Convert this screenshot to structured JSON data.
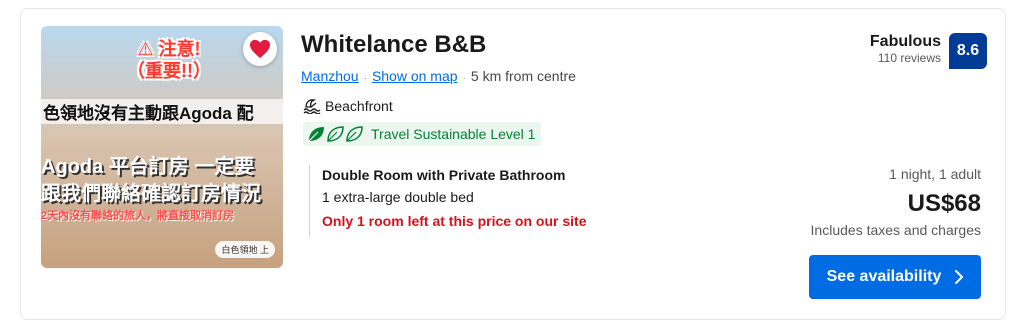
{
  "property": {
    "name": "Whitelance B&B",
    "location_link": "Manzhou",
    "map_link": "Show on map",
    "distance": "5 km from centre",
    "feature": "Beachfront",
    "sustainability": "Travel Sustainable Level 1"
  },
  "photo": {
    "warning_line1": "⚠ 注意!",
    "warning_line2": "（重要!!）",
    "text_line1": "色領地沒有主動跟Agoda 配",
    "text_line2": "Agoda 平台訂房 一定要",
    "text_line3": "跟我們聯絡確認訂房情況",
    "text_line4": "2天內沒有聯絡的旅人，將直接取消訂房",
    "location_tag": "白色領地 上"
  },
  "rating": {
    "word": "Fabulous",
    "reviews": "110 reviews",
    "score": "8.6"
  },
  "room": {
    "name": "Double Room with Private Bathroom",
    "bed": "1 extra-large double bed",
    "scarcity": "Only 1 room left at this price on our site"
  },
  "pricing": {
    "stay": "1 night, 1 adult",
    "price": "US$68",
    "taxes": "Includes taxes and charges"
  },
  "cta": {
    "label": "See availability"
  },
  "colors": {
    "brand_blue": "#006ce4",
    "score_bg": "#003b95",
    "heart_red": "#e21c3f",
    "sustain_green": "#008234",
    "scarcity_red": "#d4111e"
  }
}
